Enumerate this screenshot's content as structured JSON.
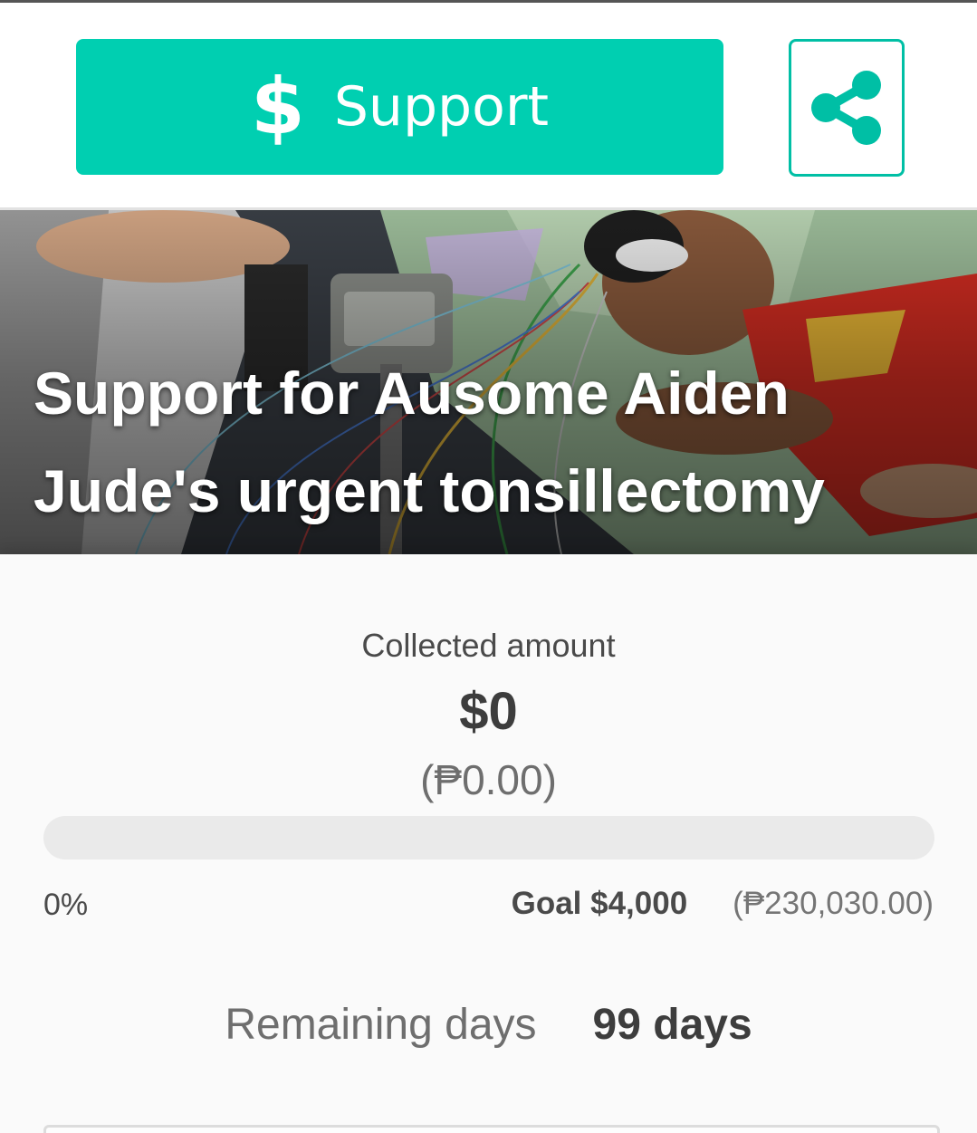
{
  "action_bar": {
    "support_icon": "$",
    "support_icon_name": "dollar-icon",
    "support_label": "Support",
    "share_icon_name": "share-icon"
  },
  "campaign": {
    "title": "Support for Ausome Aiden Jude's urgent tonsillectomy",
    "cover_image": "child-lying-with-eeg-electrodes-photo"
  },
  "funding": {
    "collected_label": "Collected amount",
    "collected_usd": "$0",
    "collected_php": "(₱0.00)",
    "progress_fraction": 0,
    "percent_label": "0%",
    "goal_usd": "Goal $4,000",
    "goal_php": "(₱230,030.00)"
  },
  "remaining": {
    "label": "Remaining days",
    "value": "99 days"
  },
  "colors": {
    "accent": "#00cfb1",
    "share_border": "#00bfa5",
    "text_dark": "#3d3d3d",
    "text_muted": "#6e6e6e",
    "track": "#eaeaea"
  }
}
